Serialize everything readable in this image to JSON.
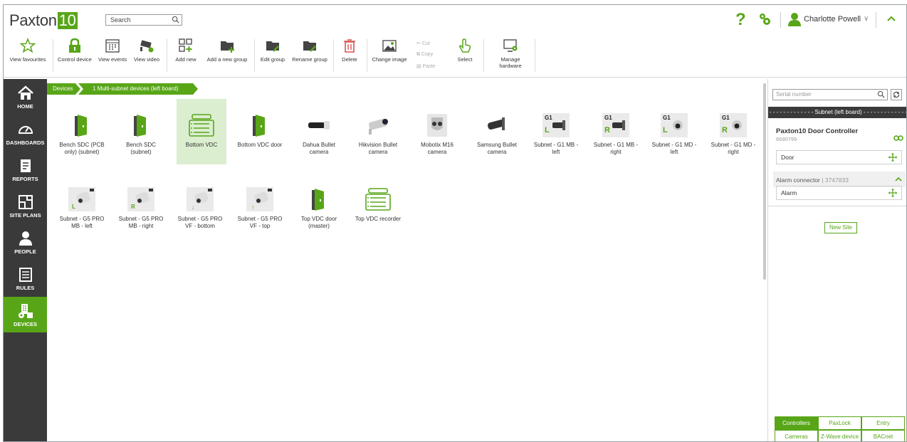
{
  "app": {
    "logo_text": "Paxton",
    "logo_num": "10"
  },
  "search": {
    "placeholder": "Search"
  },
  "user": {
    "name": "Charlotte Powell"
  },
  "colors": {
    "accent": "#58a618",
    "nav_bg": "#3a3a3a"
  },
  "ribbon": {
    "view_favourites": "View favourites",
    "control_device": "Control device",
    "view_events": "View events",
    "view_video": "View video",
    "add_new": "Add new",
    "add_group": "Add a new group",
    "edit_group": "Edit group",
    "rename_group": "Rename group",
    "delete": "Delete",
    "change_image": "Change image",
    "cut": "Cut",
    "copy": "Copy",
    "paste": "Paste",
    "select": "Select",
    "manage_hardware_1": "Manage",
    "manage_hardware_2": "hardware"
  },
  "nav": [
    {
      "label": "HOME",
      "icon": "home-icon"
    },
    {
      "label": "DASHBOARDS",
      "icon": "gauge-icon"
    },
    {
      "label": "REPORTS",
      "icon": "report-icon"
    },
    {
      "label": "SITE PLANS",
      "icon": "siteplan-icon"
    },
    {
      "label": "PEOPLE",
      "icon": "person-icon"
    },
    {
      "label": "RULES",
      "icon": "rules-icon"
    },
    {
      "label": "DEVICES",
      "icon": "devices-icon"
    }
  ],
  "breadcrumb": {
    "root": "Devices",
    "current": "1 Multi-subnet devices (left board)"
  },
  "devices": [
    {
      "l1": "Bench SDC (PCB",
      "l2": "only) (subnet)",
      "icon": "door-icon"
    },
    {
      "l1": "Bench SDC",
      "l2": "(subnet)",
      "icon": "door-icon"
    },
    {
      "l1": "Bottom VDC",
      "l2": "",
      "icon": "vdc-icon"
    },
    {
      "l1": "Bottom VDC door",
      "l2": "",
      "icon": "door-icon"
    },
    {
      "l1": "Dahua Bullet",
      "l2": "camera",
      "icon": "bullet-camera-icon"
    },
    {
      "l1": "Hikvision Bullet",
      "l2": "camera",
      "icon": "bullet-camera-icon"
    },
    {
      "l1": "Mobotix M16",
      "l2": "camera",
      "icon": "dual-camera-icon"
    },
    {
      "l1": "Samsung Bullet",
      "l2": "camera",
      "icon": "bullet-camera-icon"
    },
    {
      "l1": "Subnet - G1 MB -",
      "l2": "left",
      "icon": "g1-camera-icon"
    },
    {
      "l1": "Subnet - G1 MB -",
      "l2": "right",
      "icon": "g1-camera-icon"
    },
    {
      "l1": "Subnet - G1 MD -",
      "l2": "left",
      "icon": "g1-dome-icon"
    },
    {
      "l1": "Subnet - G1 MD -",
      "l2": "right",
      "icon": "g1-dome-icon"
    },
    {
      "l1": "Subnet - G5 PRO",
      "l2": "MB - left",
      "icon": "g5-camera-icon"
    },
    {
      "l1": "Subnet - G5 PRO",
      "l2": "MB - right",
      "icon": "g5-camera-icon"
    },
    {
      "l1": "Subnet - G5 PRO",
      "l2": "VF - bottom",
      "icon": "g5-camera-icon"
    },
    {
      "l1": "Subnet - G5 PRO",
      "l2": "VF - top",
      "icon": "g5-camera-icon"
    },
    {
      "l1": "Top VDC door",
      "l2": "(master)",
      "icon": "door-icon"
    },
    {
      "l1": "Top VDC recorder",
      "l2": "",
      "icon": "vdc-icon"
    }
  ],
  "badges": {
    "g1": "G1",
    "left": "L",
    "right": "R",
    "down": "↓",
    "up": "↑"
  },
  "panel": {
    "serial_placeholder": "Serial number",
    "subnet_header": "Subnet (left board)",
    "controller_title": "Paxton10 Door Controller",
    "controller_sn": "6690799",
    "door_slot": "Door",
    "alarm_connector": "Alarm connector",
    "alarm_connector_sn": "3747833",
    "alarm_slot": "Alarm",
    "new_site": "New Site",
    "tabs": [
      "Controllers",
      "PaxLock",
      "Entry",
      "Cameras",
      "Z-Wave device",
      "BACnet"
    ]
  }
}
